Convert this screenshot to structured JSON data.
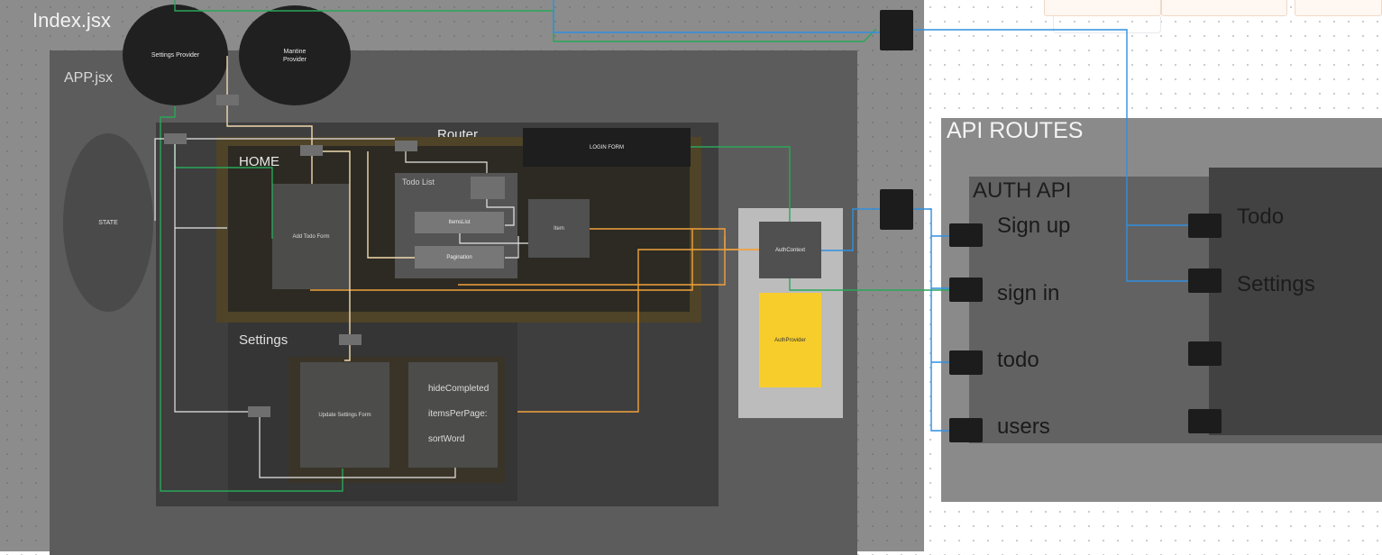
{
  "canvas": {
    "index_title": "Index.jsx",
    "app_title": "APP.jsx",
    "settings_provider": "Settings Provider",
    "mantine_provider_line1": "Mantine",
    "mantine_provider_line2": "Provider",
    "state": "STATE",
    "router_title": "Router",
    "login_form": "LOGIN FORM",
    "home_title": "HOME",
    "add_todo_form": "Add Todo Form",
    "todo_list_title": "Todo List",
    "items_list": "ItemsList",
    "pagination": "Pagination",
    "item": "Item",
    "settings_title": "Settings",
    "update_settings_form": "Update Settings Form",
    "settings_values": [
      "hideCompleted",
      "itemsPerPage:",
      "sortWord"
    ],
    "auth_context": "AuthContext",
    "auth_provider": "AuthProvider"
  },
  "api": {
    "routes_title": "API ROUTES",
    "auth_api_title": "AUTH API",
    "auth_routes": [
      "Sign up",
      "sign in",
      "todo",
      "users"
    ],
    "todo_routes": [
      "Todo",
      "Settings"
    ]
  },
  "colors": {
    "green_wire": "#2aa65a",
    "blue_wire": "#2f8fe0",
    "orange_wire": "#f0a23c",
    "cream_wire": "#f1d9b0",
    "white_wire": "#e6e6e6",
    "auth_provider_fill": "#f7cd2c"
  }
}
